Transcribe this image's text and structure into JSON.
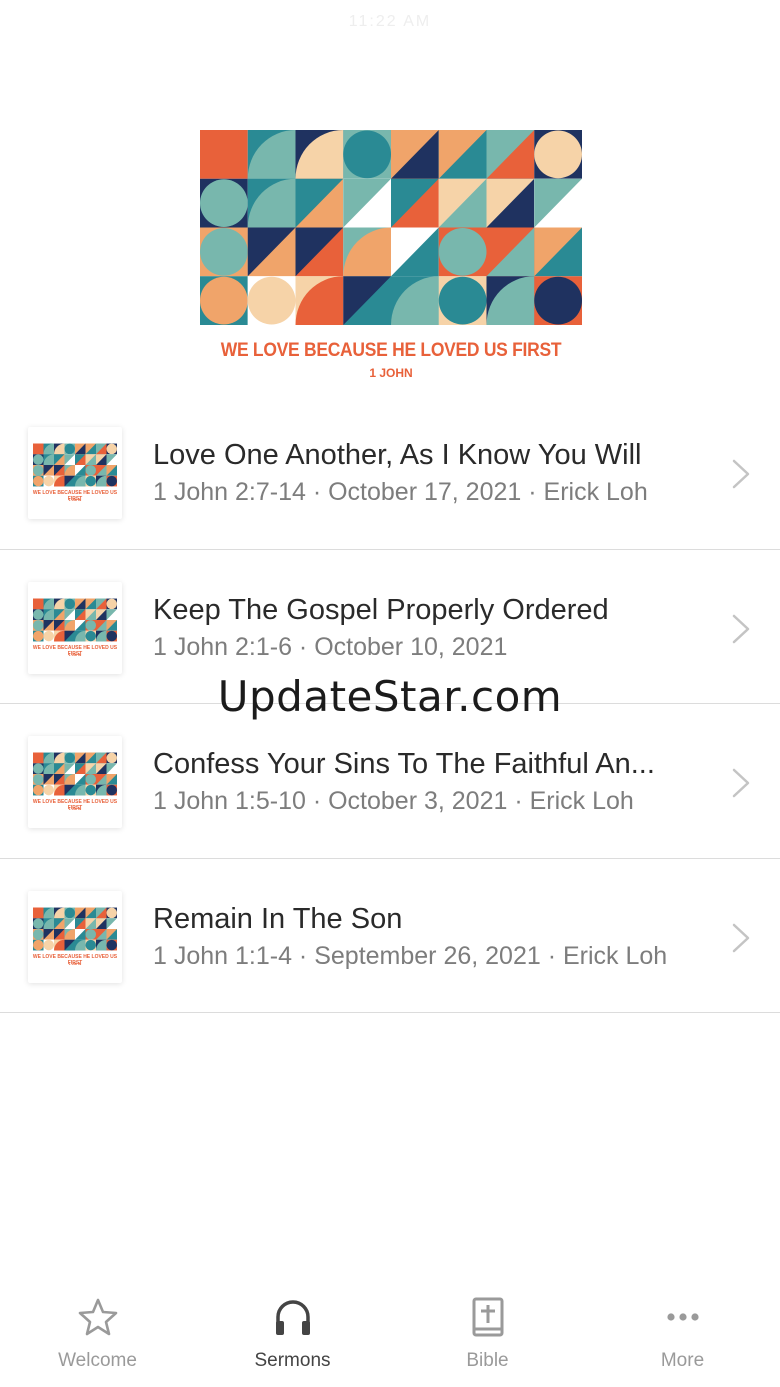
{
  "status_bar": {
    "time": "11:22 AM"
  },
  "series": {
    "title": "WE LOVE BECAUSE HE LOVED US FIRST",
    "subtitle": "1 JOHN"
  },
  "sermons": [
    {
      "title": "Love One Another, As I Know You Will",
      "meta": "1 John 2:7-14 · October 17, 2021 · Erick Loh"
    },
    {
      "title": "Keep The Gospel Properly Ordered",
      "meta": "1 John 2:1-6 · October 10, 2021"
    },
    {
      "title": "Confess Your Sins To The Faithful An...",
      "meta": "1 John 1:5-10 · October 3, 2021 · Erick Loh"
    },
    {
      "title": "Remain In The Son",
      "meta": "1 John 1:1-4 · September 26, 2021 · Erick Loh"
    }
  ],
  "watermark": "UpdateStar.com",
  "tabs": [
    {
      "label": "Welcome",
      "icon": "star-icon",
      "active": false
    },
    {
      "label": "Sermons",
      "icon": "headphones-icon",
      "active": true
    },
    {
      "label": "Bible",
      "icon": "bible-icon",
      "active": false
    },
    {
      "label": "More",
      "icon": "more-icon",
      "active": false
    }
  ],
  "colors": {
    "navy": "#1f3260",
    "teal": "#2a8a94",
    "mint": "#78b7ad",
    "orange": "#e8613a",
    "peach": "#f0a46a",
    "cream": "#f6d3a8"
  }
}
